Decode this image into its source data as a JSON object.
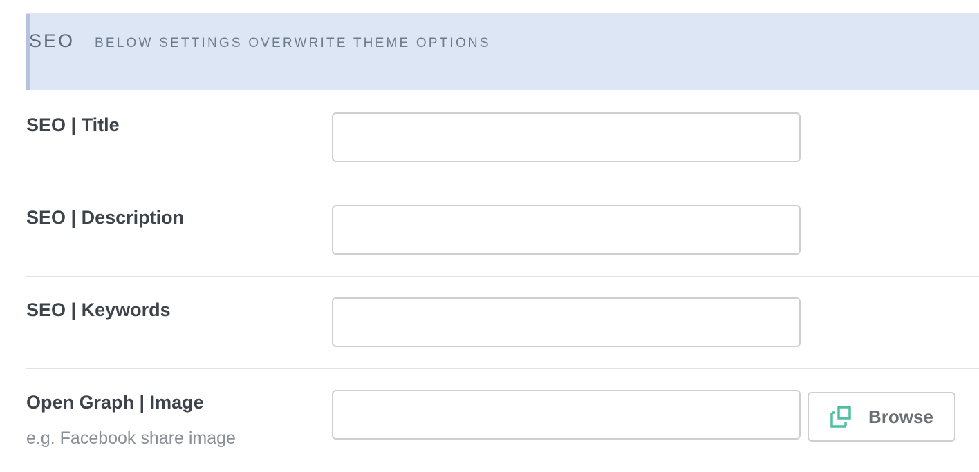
{
  "section": {
    "title": "SEO",
    "subtitle": "BELOW SETTINGS OVERWRITE THEME OPTIONS"
  },
  "fields": [
    {
      "label": "SEO | Title",
      "value": "",
      "placeholder": ""
    },
    {
      "label": "SEO | Description",
      "value": "",
      "placeholder": ""
    },
    {
      "label": "SEO | Keywords",
      "value": "",
      "placeholder": ""
    },
    {
      "label": "Open Graph | Image",
      "hint": "e.g. Facebook share image",
      "value": "",
      "placeholder": ""
    }
  ],
  "browse_button": {
    "label": "Browse",
    "icon": "media-browse-icon",
    "icon_color": "#4fbf9f"
  },
  "colors": {
    "header_background": "#dde6f5",
    "header_accent": "#b5c3df"
  }
}
